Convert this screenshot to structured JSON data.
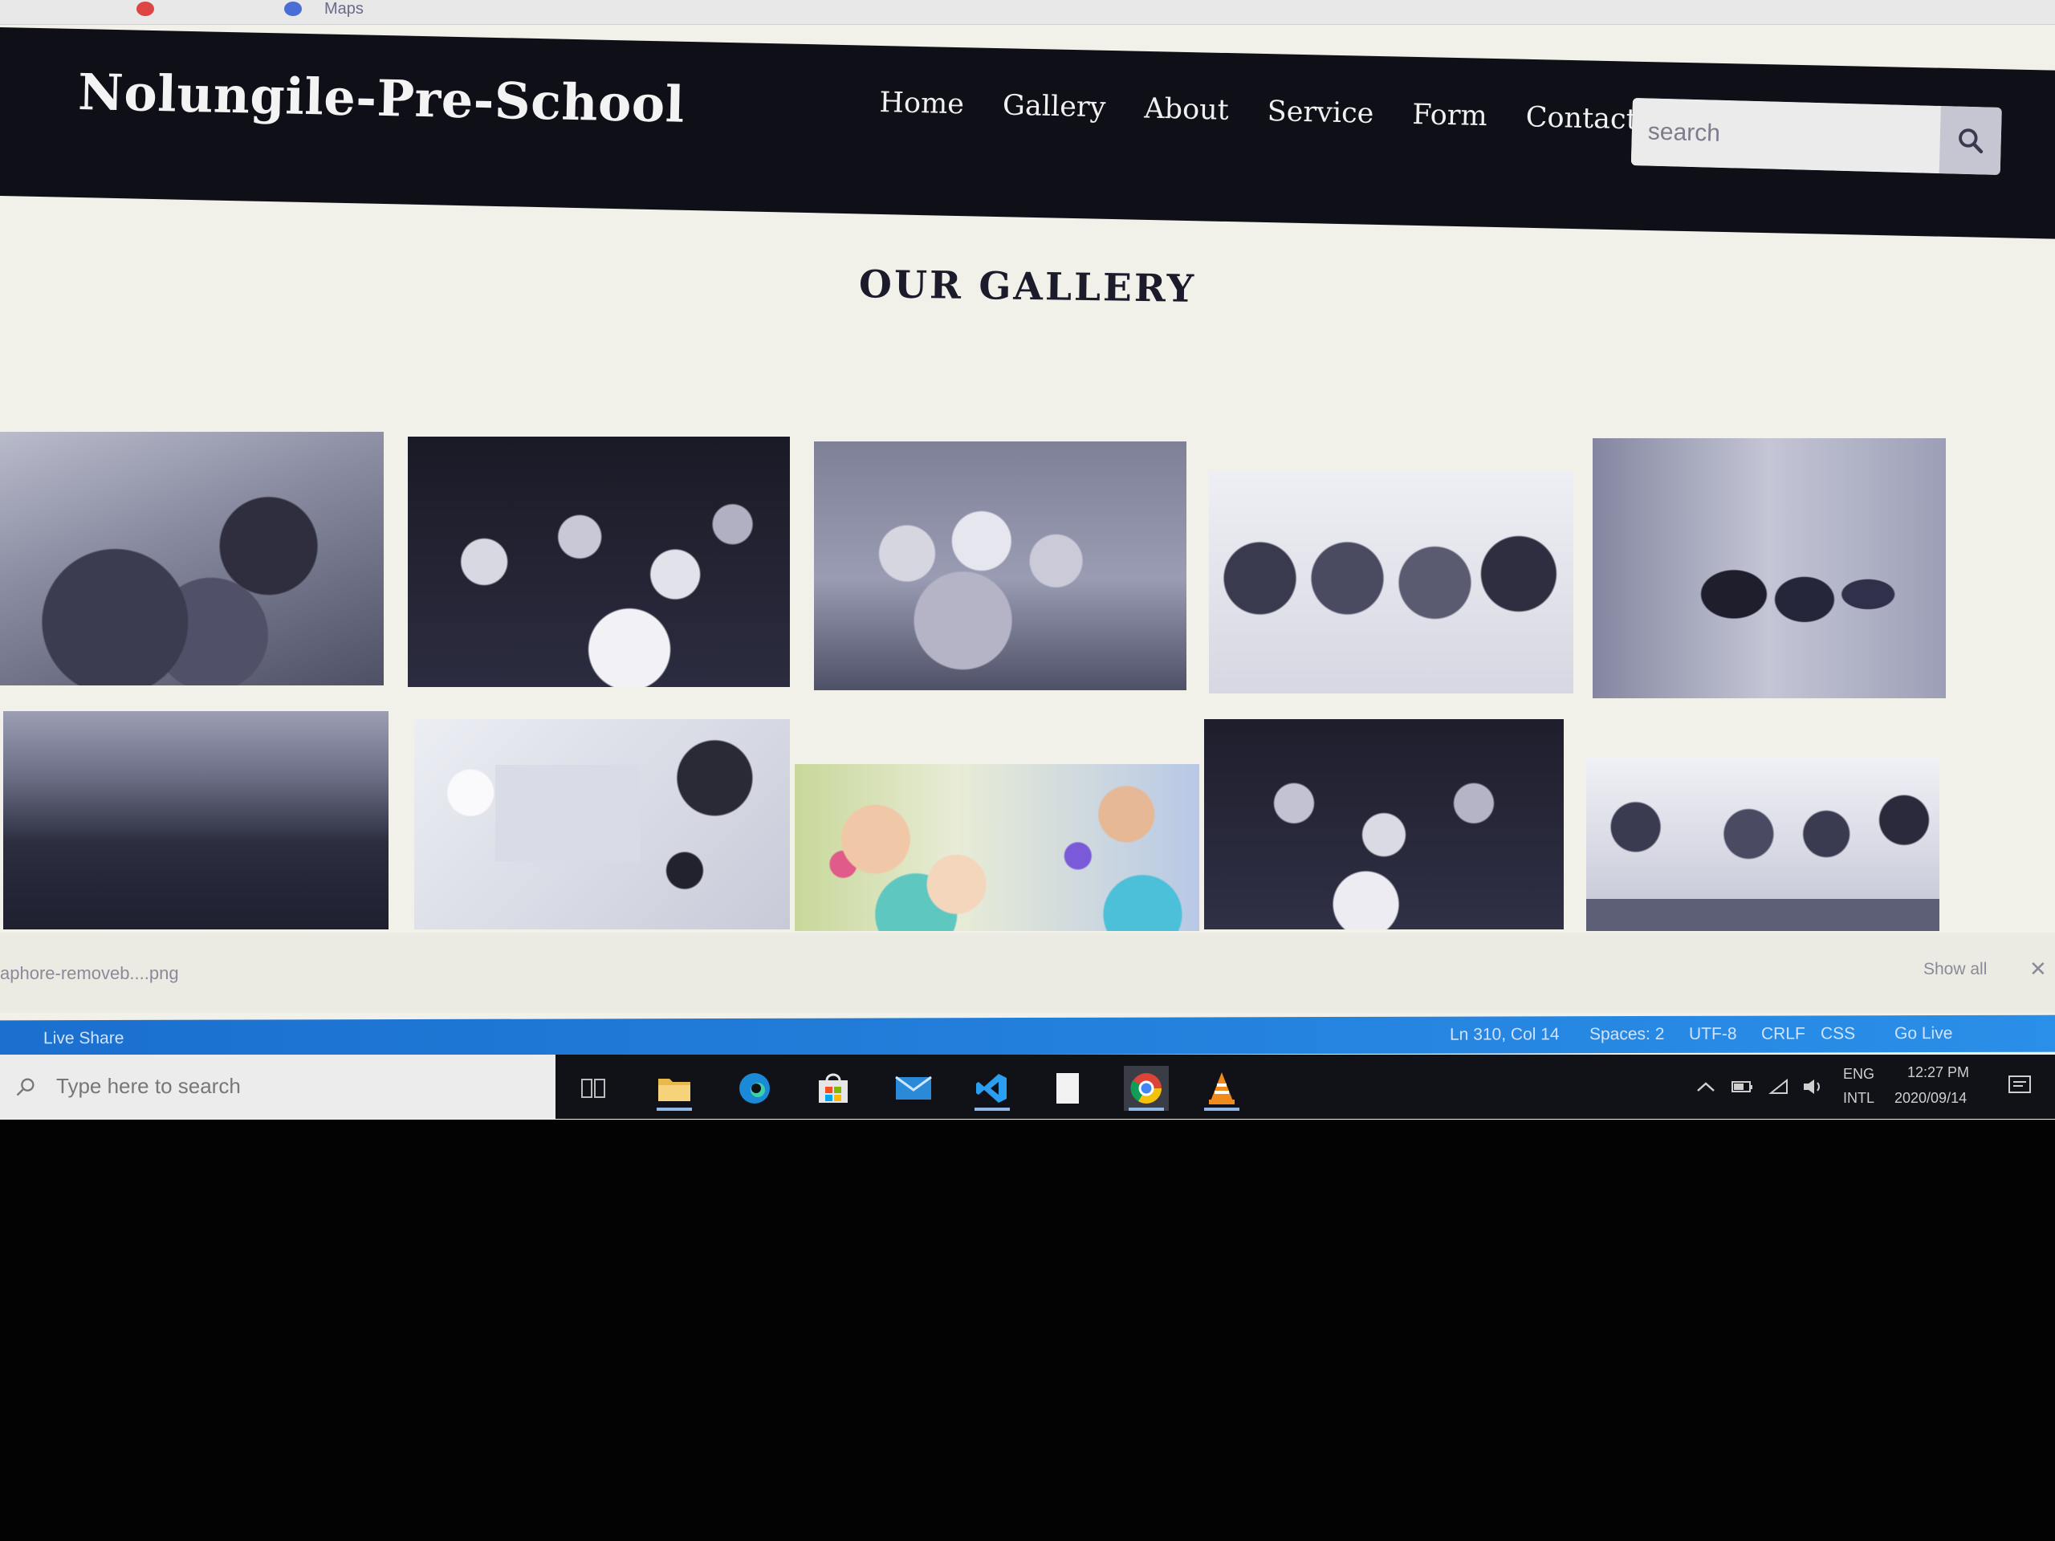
{
  "browser": {
    "tab_text": "Maps"
  },
  "site": {
    "logo": "Nolungile-Pre-School",
    "nav": [
      "Home",
      "Gallery",
      "About",
      "Service",
      "Form",
      "Contact"
    ],
    "search_placeholder": "search",
    "search_icon": "magnifier-icon"
  },
  "gallery": {
    "title": "OUR GALLERY",
    "photos": [
      {
        "subject": "children sitting in classroom with teacher",
        "tone": "grayscale"
      },
      {
        "subject": "crowd of children in graduation caps",
        "tone": "grayscale"
      },
      {
        "subject": "children sitting on floor cheering",
        "tone": "grayscale"
      },
      {
        "subject": "four children lying on floor smiling",
        "tone": "grayscale"
      },
      {
        "subject": "children in graduation gowns in hallway",
        "tone": "grayscale"
      },
      {
        "subject": "coastline and sea",
        "tone": "grayscale"
      },
      {
        "subject": "desk with laptop viewed from above",
        "tone": "grayscale"
      },
      {
        "subject": "children showing painted hands",
        "tone": "color"
      },
      {
        "subject": "crowd of children in graduation caps",
        "tone": "grayscale"
      },
      {
        "subject": "children playing at table",
        "tone": "grayscale"
      }
    ]
  },
  "download_bar": {
    "file": "aphore-removeb....png",
    "show_all": "Show all",
    "close": "✕"
  },
  "status_bar": {
    "live_share": "Live Share",
    "items": [
      "Ln 310, Col 14",
      "Spaces: 2",
      "UTF-8",
      "CRLF",
      "CSS",
      "Go Live"
    ]
  },
  "taskbar": {
    "search_placeholder": "Type here to search",
    "apps": [
      "task-view-icon",
      "file-explorer-icon",
      "edge-icon",
      "store-icon",
      "mail-icon",
      "vscode-icon",
      "notepad-icon",
      "chrome-icon",
      "vlc-icon"
    ],
    "lang_top": "ENG",
    "lang_bottom": "INTL",
    "time": "12:27 PM",
    "date": "2020/09/14"
  },
  "colors": {
    "nav_bg": "#0f0f17",
    "page_bg": "#f2f1e9",
    "status_bar": "#1b6fce",
    "taskbar": "#101218"
  }
}
